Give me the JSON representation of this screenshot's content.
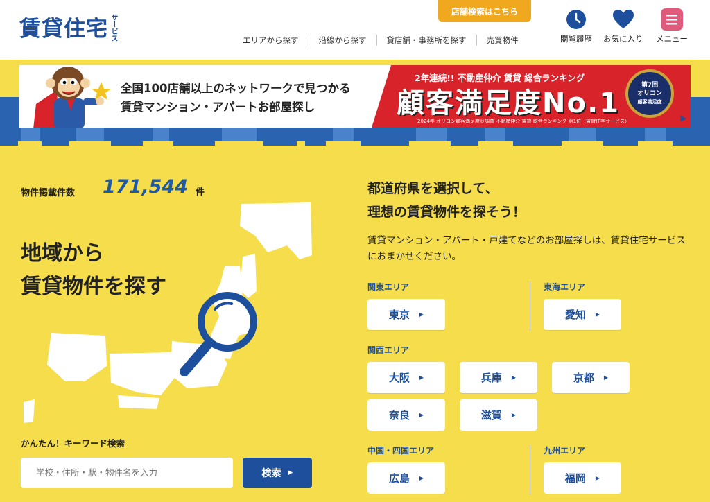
{
  "header": {
    "logo_main": "賃貸住宅",
    "logo_sub": "サービス",
    "store_search": "店舗検索はこちら",
    "nav": [
      "エリアから探す",
      "沿線から探す",
      "貸店舗・事務所を探す",
      "売買物件"
    ],
    "icons": [
      {
        "label": "閲覧履歴",
        "icon": "clock-icon"
      },
      {
        "label": "お気に入り",
        "icon": "heart-icon"
      },
      {
        "label": "メニュー",
        "icon": "menu-icon"
      }
    ]
  },
  "banner": {
    "line1": "全国100店舗以上のネットワークで見つかる",
    "line2": "賃貸マンション・アパートお部屋探し",
    "rank_top": "2年連続!! 不動産仲介 賃貸 総合ランキング",
    "rank_main": "顧客満足度No.1",
    "rank_note": "2024年 オリコン顧客満足度®調査 不動産仲介 賃貸 総合ランキング 第1位（賃貸住宅サービス）",
    "medal_top": "第7回",
    "medal_mid": "オリコン",
    "medal_bottom": "顧客満足度"
  },
  "left": {
    "count_label": "物件掲載件数",
    "count_value": "171,544",
    "count_unit": "件",
    "title_line1": "地域から",
    "title_line2": "賃貸物件を探す",
    "keyword_label": "かんたん！キーワード検索",
    "keyword_placeholder": "学校・住所・駅・物件名を入力",
    "search_button": "検索"
  },
  "right": {
    "heading_line1": "都道府県を選択して、",
    "heading_line2": "理想の賃貸物件を探そう！",
    "description": "賃貸マンション・アパート・戸建てなどのお部屋探しは、賃貸住宅サービスにおまかせください。",
    "areas": {
      "kanto": {
        "label": "関東エリア",
        "prefs": [
          "東京"
        ]
      },
      "tokai": {
        "label": "東海エリア",
        "prefs": [
          "愛知"
        ]
      },
      "kansai": {
        "label": "関西エリア",
        "prefs": [
          "大阪",
          "兵庫",
          "京都",
          "奈良",
          "滋賀"
        ]
      },
      "chushikoku": {
        "label": "中国・四国エリア",
        "prefs": [
          "広島"
        ]
      },
      "kyushu": {
        "label": "九州エリア",
        "prefs": [
          "福岡"
        ]
      }
    }
  },
  "colors": {
    "background": "#f5dd4c",
    "brand_blue": "#1d4f9c",
    "accent_orange": "#f0a81e",
    "ranking_red": "#d9232a",
    "menu_pink": "#e05a7b"
  }
}
